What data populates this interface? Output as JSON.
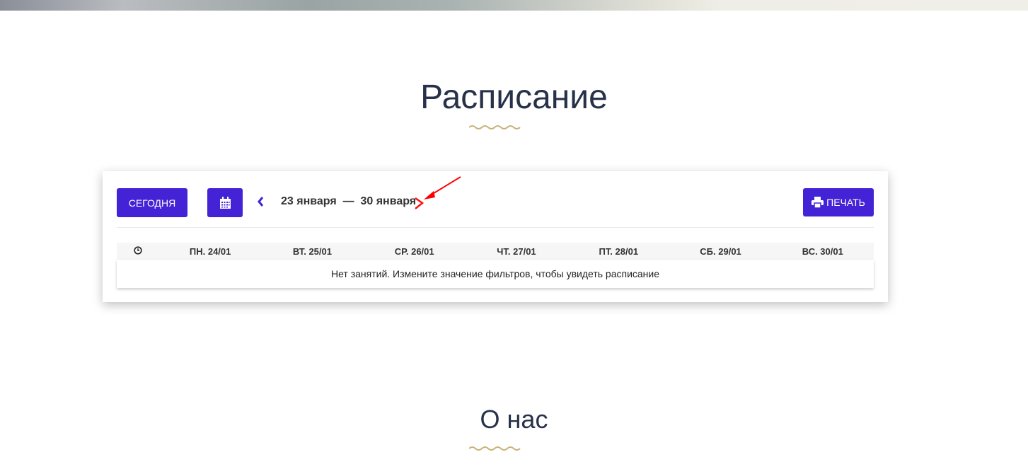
{
  "sections": {
    "schedule_title": "Расписание",
    "about_title": "О нас"
  },
  "toolbar": {
    "today_label": "СЕГОДНЯ",
    "calendar_icon": "calendar-icon",
    "prev_icon": "chevron-left-icon",
    "range_start": "23 января",
    "range_dash": "—",
    "range_end": "30 января",
    "next_icon": "chevron-right-icon",
    "print_label": "ПЕЧАТЬ",
    "print_icon": "printer-icon"
  },
  "table": {
    "time_icon": "clock-icon",
    "days": [
      "ПН. 24/01",
      "ВТ. 25/01",
      "СР. 26/01",
      "ЧТ. 27/01",
      "ПТ. 28/01",
      "СБ. 29/01",
      "ВС. 30/01"
    ],
    "empty_message": "Нет занятий. Измените значение фильтров, чтобы увидеть расписание"
  },
  "colors": {
    "accent": "#4422d6",
    "title": "#27324a",
    "wave": "#c8b27a",
    "annotation": "#ff0000"
  }
}
